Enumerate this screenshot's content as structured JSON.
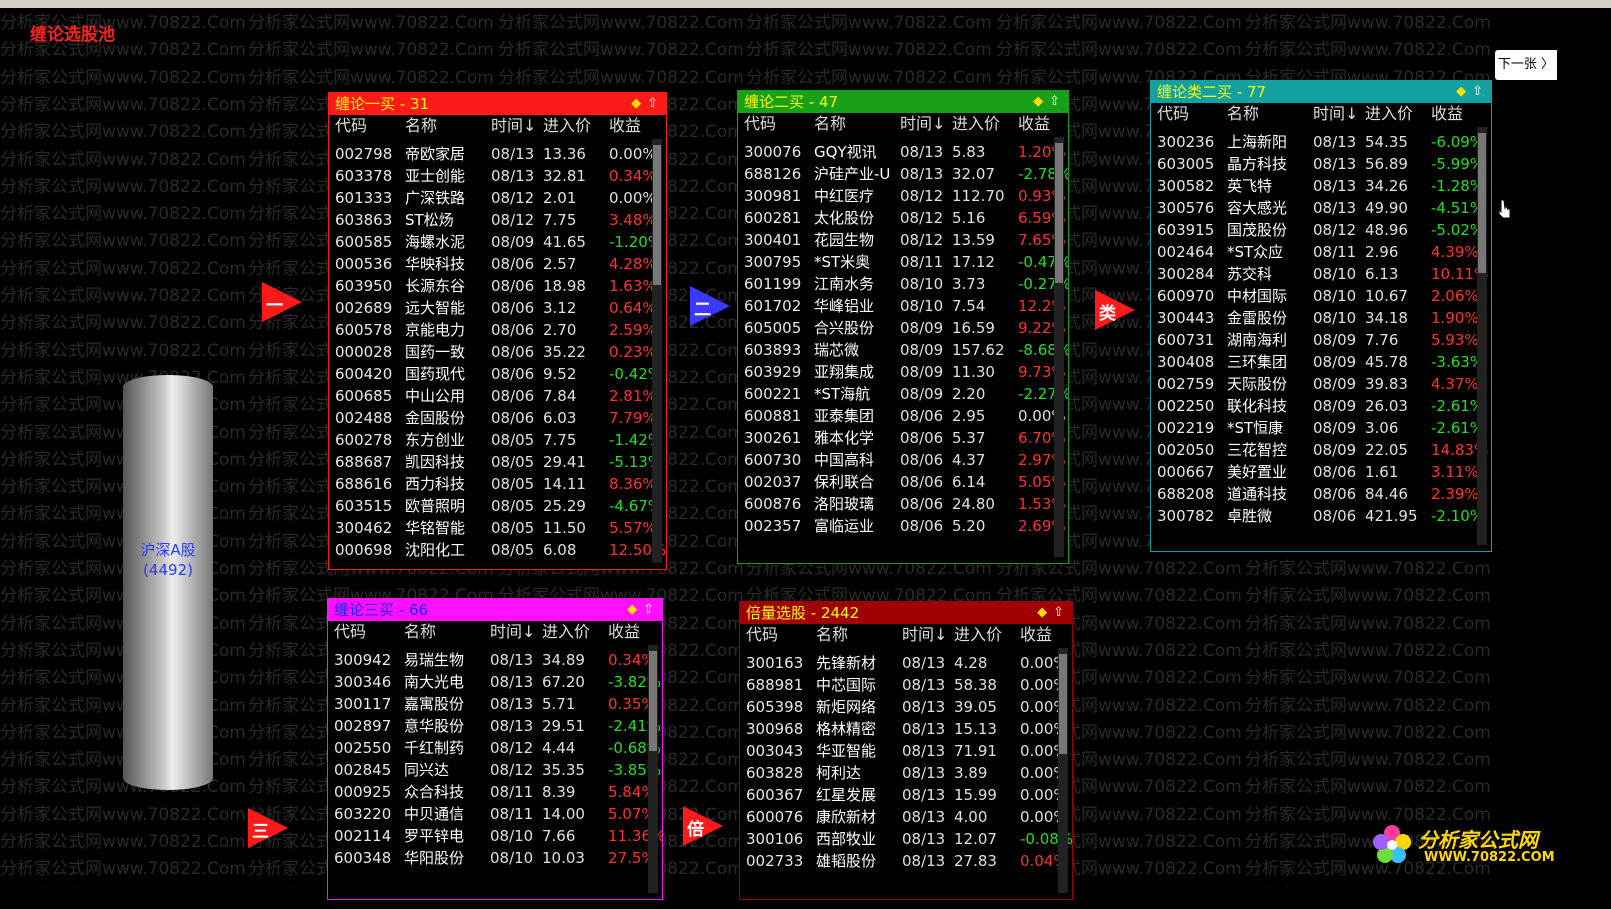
{
  "app_title": "缠论选股池",
  "next_button": "下一张 〉",
  "watermark_text": "分析家公式网www.70822.Com",
  "cylinder": {
    "line1": "沪深A股",
    "line2": "(4492)"
  },
  "arrows": [
    {
      "id": "arrow-1",
      "label": "一",
      "color": "#ff1a1a"
    },
    {
      "id": "arrow-2",
      "label": "二",
      "color": "#3a3aff"
    },
    {
      "id": "arrow-lei",
      "label": "类",
      "color": "#ff1a1a"
    },
    {
      "id": "arrow-3",
      "label": "三",
      "color": "#ff1a1a"
    },
    {
      "id": "arrow-bei",
      "label": "倍",
      "color": "#ff1a1a"
    }
  ],
  "columns": {
    "code": "代码",
    "name": "名称",
    "time": "时间↓",
    "price": "进入价",
    "gain": "收益"
  },
  "panels": [
    {
      "id": "panel-1",
      "title": "缠论一买 - 31",
      "color": "#ff1a1a",
      "title_color": "#ffff00",
      "rows": [
        [
          "002798",
          "帝欧家居",
          "08/13",
          "13.36",
          "0.00%"
        ],
        [
          "603378",
          "亚士创能",
          "08/13",
          "32.81",
          "0.34%"
        ],
        [
          "601333",
          "广深铁路",
          "08/12",
          "2.01",
          "0.00%"
        ],
        [
          "603863",
          "ST松炀",
          "08/12",
          "7.75",
          "3.48%"
        ],
        [
          "600585",
          "海螺水泥",
          "08/09",
          "41.65",
          "-1.20%"
        ],
        [
          "000536",
          "华映科技",
          "08/06",
          "2.57",
          "4.28%"
        ],
        [
          "603950",
          "长源东谷",
          "08/06",
          "18.98",
          "1.63%"
        ],
        [
          "002689",
          "远大智能",
          "08/06",
          "3.12",
          "0.64%"
        ],
        [
          "600578",
          "京能电力",
          "08/06",
          "2.70",
          "2.59%"
        ],
        [
          "000028",
          "国药一致",
          "08/06",
          "35.22",
          "0.23%"
        ],
        [
          "600420",
          "国药现代",
          "08/06",
          "9.52",
          "-0.42%"
        ],
        [
          "600685",
          "中山公用",
          "08/06",
          "7.84",
          "2.81%"
        ],
        [
          "002488",
          "金固股份",
          "08/06",
          "6.03",
          "7.79%"
        ],
        [
          "600278",
          "东方创业",
          "08/05",
          "7.75",
          "-1.42%"
        ],
        [
          "688687",
          "凯因科技",
          "08/05",
          "29.41",
          "-5.13%"
        ],
        [
          "688616",
          "西力科技",
          "08/05",
          "14.11",
          "8.36%"
        ],
        [
          "603515",
          "欧普照明",
          "08/05",
          "25.29",
          "-4.67%"
        ],
        [
          "300462",
          "华铭智能",
          "08/05",
          "11.50",
          "5.57%"
        ],
        [
          "000698",
          "沈阳化工",
          "08/05",
          "6.08",
          "12.50%"
        ]
      ]
    },
    {
      "id": "panel-2",
      "title": "缠论二买 - 47",
      "color": "#18a018",
      "title_color": "#ffff00",
      "rows": [
        [
          "300076",
          "GQY视讯",
          "08/13",
          "5.83",
          "1.20%"
        ],
        [
          "688126",
          "沪硅产业-U",
          "08/13",
          "32.07",
          "-2.78%"
        ],
        [
          "300981",
          "中红医疗",
          "08/12",
          "112.70",
          "0.93%"
        ],
        [
          "600281",
          "太化股份",
          "08/12",
          "5.16",
          "6.59%"
        ],
        [
          "300401",
          "花园生物",
          "08/12",
          "13.59",
          "7.65%"
        ],
        [
          "300795",
          "*ST米奥",
          "08/11",
          "17.12",
          "-0.47%"
        ],
        [
          "601199",
          "江南水务",
          "08/10",
          "3.73",
          "-0.27%"
        ],
        [
          "601702",
          "华峰铝业",
          "08/10",
          "7.54",
          "12.2%"
        ],
        [
          "605005",
          "合兴股份",
          "08/09",
          "16.59",
          "9.22%"
        ],
        [
          "603893",
          "瑞芯微",
          "08/09",
          "157.62",
          "-8.68%"
        ],
        [
          "603929",
          "亚翔集成",
          "08/09",
          "11.30",
          "9.73%"
        ],
        [
          "600221",
          "*ST海航",
          "08/09",
          "2.20",
          "-2.27%"
        ],
        [
          "600881",
          "亚泰集团",
          "08/06",
          "2.95",
          "0.00%"
        ],
        [
          "300261",
          "雅本化学",
          "08/06",
          "5.37",
          "6.70%"
        ],
        [
          "600730",
          "中国高科",
          "08/06",
          "4.37",
          "2.97%"
        ],
        [
          "002037",
          "保利联合",
          "08/06",
          "6.14",
          "5.05%"
        ],
        [
          "600876",
          "洛阳玻璃",
          "08/06",
          "24.80",
          "1.53%"
        ],
        [
          "002357",
          "富临运业",
          "08/06",
          "5.20",
          "2.69%"
        ]
      ]
    },
    {
      "id": "panel-lei",
      "title": "缠论类二买 - 77",
      "color": "#13a0a0",
      "title_color": "#ffff00",
      "rows": [
        [
          "300236",
          "上海新阳",
          "08/13",
          "54.35",
          "-6.09%"
        ],
        [
          "603005",
          "晶方科技",
          "08/13",
          "56.89",
          "-5.99%"
        ],
        [
          "300582",
          "英飞特",
          "08/13",
          "34.26",
          "-1.28%"
        ],
        [
          "300576",
          "容大感光",
          "08/13",
          "49.90",
          "-4.51%"
        ],
        [
          "603915",
          "国茂股份",
          "08/12",
          "48.96",
          "-5.02%"
        ],
        [
          "002464",
          "*ST众应",
          "08/11",
          "2.96",
          "4.39%"
        ],
        [
          "300284",
          "苏交科",
          "08/10",
          "6.13",
          "10.11%"
        ],
        [
          "600970",
          "中材国际",
          "08/10",
          "10.67",
          "2.06%"
        ],
        [
          "300443",
          "金雷股份",
          "08/10",
          "34.18",
          "1.90%"
        ],
        [
          "600731",
          "湖南海利",
          "08/09",
          "7.76",
          "5.93%"
        ],
        [
          "300408",
          "三环集团",
          "08/09",
          "45.78",
          "-3.63%"
        ],
        [
          "002759",
          "天际股份",
          "08/09",
          "39.83",
          "4.37%"
        ],
        [
          "002250",
          "联化科技",
          "08/09",
          "26.03",
          "-2.61%"
        ],
        [
          "002219",
          "*ST恒康",
          "08/09",
          "3.06",
          "-2.61%"
        ],
        [
          "002050",
          "三花智控",
          "08/09",
          "22.05",
          "14.83%"
        ],
        [
          "000667",
          "美好置业",
          "08/06",
          "1.61",
          "3.11%"
        ],
        [
          "688208",
          "道通科技",
          "08/06",
          "84.46",
          "2.39%"
        ],
        [
          "300782",
          "卓胜微",
          "08/06",
          "421.95",
          "-2.10%"
        ]
      ]
    },
    {
      "id": "panel-3",
      "title": "缠论三买 - 66",
      "color": "#ff10ff",
      "title_color": "#2020ff",
      "rows": [
        [
          "300942",
          "易瑞生物",
          "08/13",
          "34.89",
          "0.34%"
        ],
        [
          "300346",
          "南大光电",
          "08/13",
          "67.20",
          "-3.82%"
        ],
        [
          "300117",
          "嘉寓股份",
          "08/13",
          "5.71",
          "0.35%"
        ],
        [
          "002897",
          "意华股份",
          "08/13",
          "29.51",
          "-2.41%"
        ],
        [
          "002550",
          "千红制药",
          "08/12",
          "4.44",
          "-0.68%"
        ],
        [
          "002845",
          "同兴达",
          "08/12",
          "35.35",
          "-3.85%"
        ],
        [
          "000925",
          "众合科技",
          "08/11",
          "8.39",
          "5.84%"
        ],
        [
          "603220",
          "中贝通信",
          "08/11",
          "14.00",
          "5.07%"
        ],
        [
          "002114",
          "罗平锌电",
          "08/10",
          "7.66",
          "11.36%"
        ],
        [
          "600348",
          "华阳股份",
          "08/10",
          "10.03",
          "27.5%"
        ]
      ]
    },
    {
      "id": "panel-bei",
      "title": "倍量选股 - 2442",
      "color": "#a00000",
      "title_color": "#ffff00",
      "rows": [
        [
          "300163",
          "先锋新材",
          "08/13",
          "4.28",
          "0.00%"
        ],
        [
          "688981",
          "中芯国际",
          "08/13",
          "58.38",
          "0.00%"
        ],
        [
          "605398",
          "新炬网络",
          "08/13",
          "39.05",
          "0.00%"
        ],
        [
          "300968",
          "格林精密",
          "08/13",
          "15.13",
          "0.00%"
        ],
        [
          "003043",
          "华亚智能",
          "08/13",
          "71.91",
          "0.00%"
        ],
        [
          "603828",
          "柯利达",
          "08/13",
          "3.89",
          "0.00%"
        ],
        [
          "600367",
          "红星发展",
          "08/13",
          "15.99",
          "0.00%"
        ],
        [
          "600076",
          "康欣新材",
          "08/13",
          "4.00",
          "0.00%"
        ],
        [
          "300106",
          "西部牧业",
          "08/13",
          "12.07",
          "-0.08%"
        ],
        [
          "002733",
          "雄韬股份",
          "08/13",
          "27.83",
          "0.04%"
        ]
      ]
    }
  ],
  "logo": {
    "line1": "分析家公式网",
    "line2": "WWW.70822.COM"
  }
}
